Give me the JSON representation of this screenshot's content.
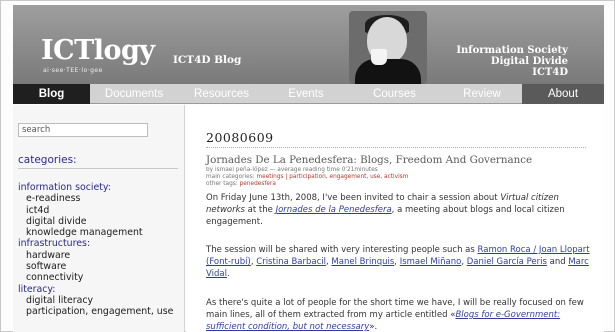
{
  "header": {
    "logo": "ICTlogy",
    "logo_sub": "ai·see·TEE·lo·gee",
    "blog_label": "ICT4D Blog",
    "tagline_lines": [
      "Information Society",
      "Digital Divide",
      "ICT4D"
    ]
  },
  "nav": {
    "items": [
      {
        "label": "Blog"
      },
      {
        "label": "Documents"
      },
      {
        "label": "Resources"
      },
      {
        "label": "Events"
      },
      {
        "label": "Courses"
      },
      {
        "label": "Review"
      },
      {
        "label": "About"
      }
    ]
  },
  "sidebar": {
    "search_placeholder": "search",
    "categories_title": "categories:",
    "groups": [
      {
        "title": "information society:",
        "items": [
          "e-readiness",
          "ict4d",
          "digital divide",
          "knowledge management"
        ]
      },
      {
        "title": "infrastructures:",
        "items": [
          "hardware",
          "software",
          "connectivity"
        ]
      },
      {
        "title": "literacy:",
        "items": [
          "digital literacy",
          "participation, engagement, use"
        ]
      }
    ]
  },
  "main": {
    "date": "20080609",
    "post_title": "Jornades De La Penedesfera: Blogs, Freedom And Governance",
    "meta_line1": "by ismael peña-lópez — average reading time 0'21minutes",
    "meta_line2_prefix": "main categories:",
    "meta_line2_links": "meetings | participation, engagement, use, activism",
    "meta_line3_prefix": "other tags:",
    "meta_line3_link": "penedesfera",
    "p1_a": "On Friday June 13th, 2008, I've been invited to chair a session about",
    "p1_italic": "Virtual citizen networks",
    "p1_b": "at the",
    "p1_link": "Jornades de la Penedesfera",
    "p1_c": ", a meeting about blogs and local citizen engagement.",
    "p2_a": "The session will be shared with very interesting people such as",
    "p2_links": [
      "Ramon Roca / Joan Llopart (Font-rubí)",
      "Cristina Barbacil",
      "Manel Brinquis",
      "Ismael Miñano",
      "Daniel García Peris"
    ],
    "p2_and": "and",
    "p2_last": "Marc Vidal",
    "p3_a": "As there's quite a lot of people for the short time we have, I will be really focused on few main lines, all of them extracted from my article entitled «",
    "p3_link": "Blogs for e-Government: sufficient condition, but not necessary",
    "p3_b": "»."
  }
}
